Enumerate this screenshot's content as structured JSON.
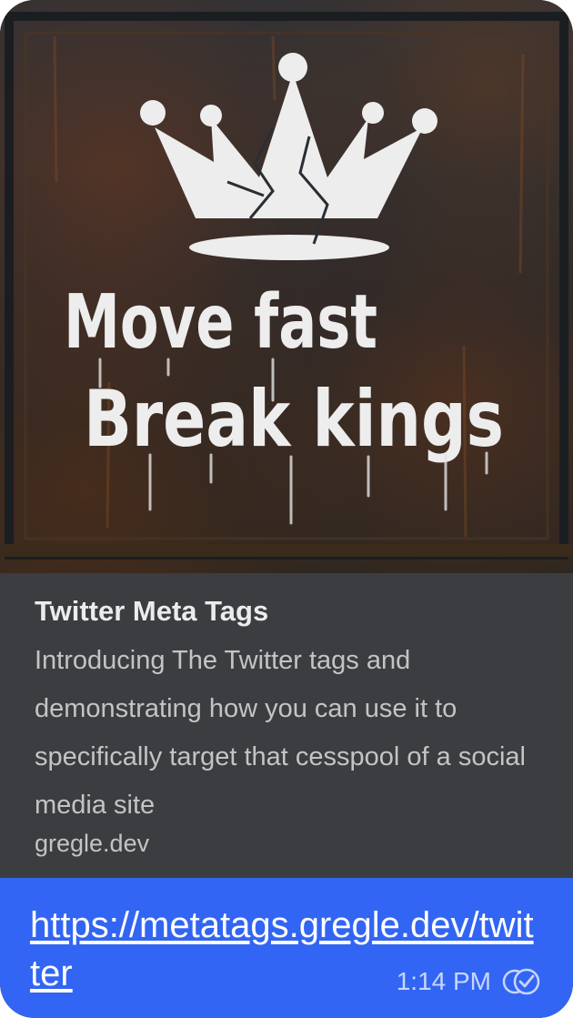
{
  "preview": {
    "image_icon": "crown-graffiti-image",
    "image_text_line1": "Move fast",
    "image_text_line2": "Break kings",
    "title": "Twitter Meta Tags",
    "description": "Introducing The Twitter tags and demonstrating how you can use it to specifically target that cesspool of a social media site",
    "domain": "gregle.dev"
  },
  "message": {
    "link_text": "https://metatags.gregle.dev/twitter",
    "timestamp": "1:14 PM",
    "status_icon": "read-check-icon"
  },
  "colors": {
    "card_background": "#3b3d40",
    "bubble_blue": "#3265f3",
    "link": "#ffffff",
    "timestamp": "#c9d6fb"
  }
}
